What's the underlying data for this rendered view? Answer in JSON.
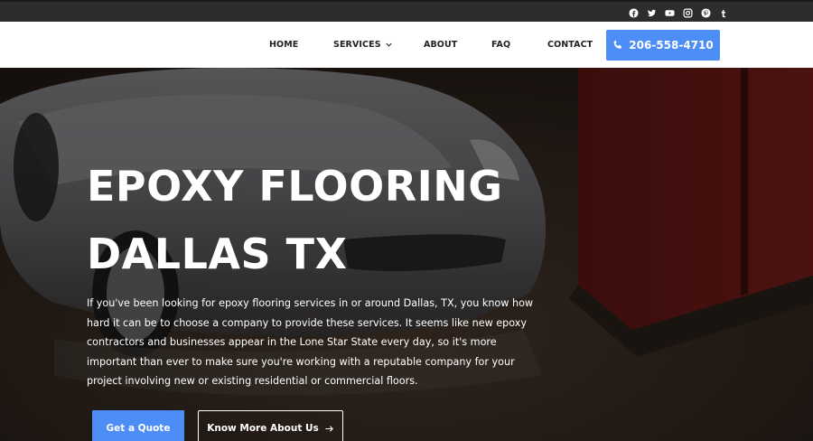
{
  "social": {
    "icons": [
      "facebook-icon",
      "twitter-icon",
      "youtube-icon",
      "instagram-icon",
      "pinterest-icon",
      "tumblr-icon"
    ]
  },
  "nav": {
    "home": "HOME",
    "services": "SERVICES",
    "about": "ABOUT",
    "faq": "FAQ",
    "contact": "CONTACT",
    "phone": "206-558-4710"
  },
  "hero": {
    "title_line1": "EPOXY FLOORING",
    "title_line2": "DALLAS TX",
    "paragraph": "If you've been looking for epoxy flooring services in or around Dallas, TX, you know how hard it can be to choose a company to provide these services. It seems like new epoxy contractors and businesses appear in the Lone Star State every day, so it's more important than ever to make sure you're working with a reputable company for your project involving new or existing residential or commercial floors.",
    "primary_button": "Get a Quote",
    "secondary_button": "Know More About Us"
  },
  "colors": {
    "accent": "#4d8df6",
    "topbar": "#2d2d2f",
    "nav_bg": "#ffffff"
  }
}
